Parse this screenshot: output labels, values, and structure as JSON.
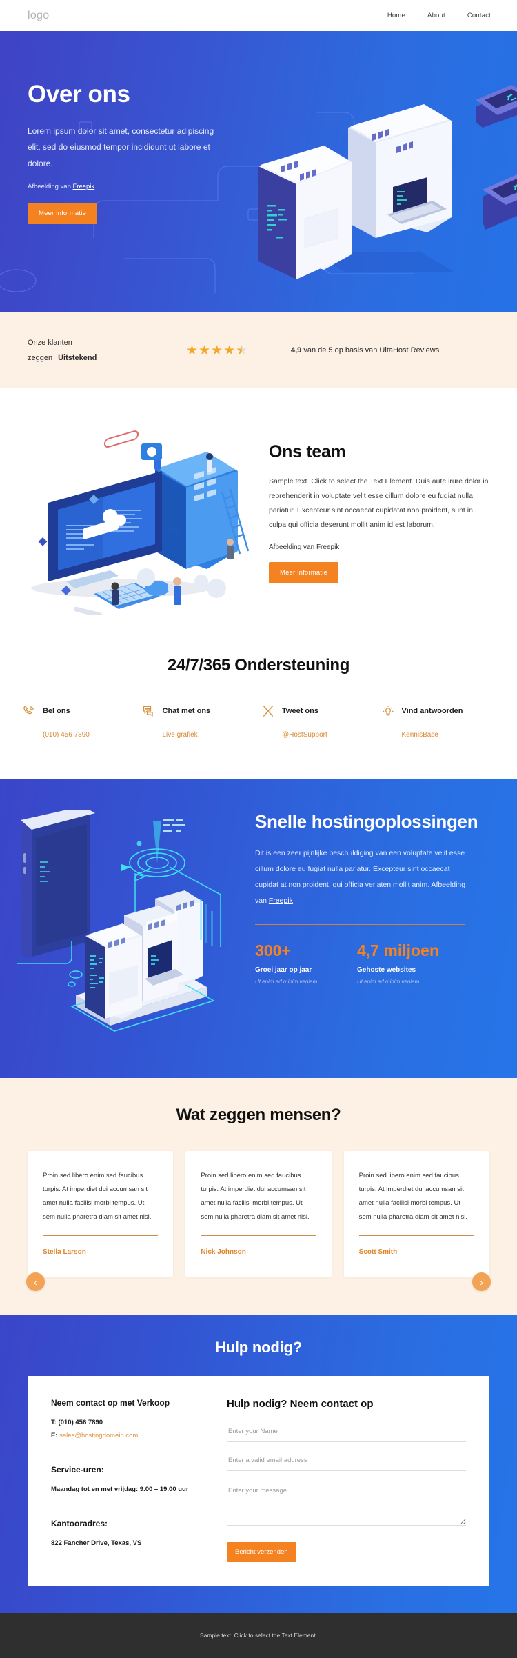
{
  "nav": {
    "logo": "logo",
    "links": [
      {
        "label": "Home"
      },
      {
        "label": "About"
      },
      {
        "label": "Contact"
      }
    ]
  },
  "hero": {
    "title": "Over ons",
    "body": "Lorem ipsum dolor sit amet, consectetur adipiscing elit, sed do eiusmod tempor incididunt ut labore et dolore.",
    "credit_prefix": "Afbeelding van ",
    "credit_link": "Freepik",
    "cta": "Meer informatie",
    "bg_from": "#3f43c4",
    "bg_to": "#2472e6"
  },
  "reviews": {
    "line1": "Onze klanten",
    "line2": "zeggen",
    "rating_word": "Uitstekend",
    "stars": 4.5,
    "score": "4,9",
    "score_text": " van de 5 op basis van UltaHost Reviews",
    "bg": "#fdf0e4",
    "star_color": "#f5a623"
  },
  "team": {
    "title": "Ons team",
    "body": "Sample text. Click to select the Text Element. Duis aute irure dolor in reprehenderit in voluptate velit esse cillum dolore eu fugiat nulla pariatur. Excepteur sint occaecat cupidatat non proident, sunt in culpa qui officia deserunt mollit anim id est laborum.",
    "credit_prefix": "Afbeelding van ",
    "credit_link": "Freepik",
    "cta": "Meer informatie"
  },
  "support": {
    "title": "24/7/365 Ondersteuning",
    "items": [
      {
        "icon": "phone-icon",
        "title": "Bel ons",
        "link": "(010) 456 7890"
      },
      {
        "icon": "chat-icon",
        "title": "Chat met ons",
        "link": "Live grafiek"
      },
      {
        "icon": "x-twitter-icon",
        "title": "Tweet ons",
        "link": "@HostSupport"
      },
      {
        "icon": "lightbulb-icon",
        "title": "Vind antwoorden",
        "link": "KennisBase"
      }
    ]
  },
  "hosting": {
    "title": "Snelle hostingoplossingen",
    "body": "Dit is een zeer pijnlijke beschuldiging van een voluptate velit esse cillum dolore eu fugiat nulla pariatur. Excepteur sint occaecat cupidat at non proident, qui officia verlaten mollit anim. ",
    "credit_prefix": "Afbeelding van ",
    "credit_link": "Freepik",
    "stats": [
      {
        "number": "300+",
        "label": "Groei jaar op jaar",
        "sub": "Ut enim ad minim veniam"
      },
      {
        "number": "4,7 miljoen",
        "label": "Gehoste websites",
        "sub": "Ut enim ad minim veniam"
      }
    ],
    "accent": "#f58220"
  },
  "testimonials": {
    "title": "Wat zeggen mensen?",
    "prev_icon": "chevron-left-icon",
    "next_icon": "chevron-right-icon",
    "cards": [
      {
        "quote": "Proin sed libero enim sed faucibus turpis. At imperdiet dui accumsan sit amet nulla facilisi morbi tempus. Ut sem nulla pharetra diam sit amet nisl.",
        "name": "Stella Larson"
      },
      {
        "quote": "Proin sed libero enim sed faucibus turpis. At imperdiet dui accumsan sit amet nulla facilisi morbi tempus. Ut sem nulla pharetra diam sit amet nisl.",
        "name": "Nick Johnson"
      },
      {
        "quote": "Proin sed libero enim sed faucibus turpis. At imperdiet dui accumsan sit amet nulla facilisi morbi tempus. Ut sem nulla pharetra diam sit amet nisl.",
        "name": "Scott Smith"
      }
    ]
  },
  "contact": {
    "title": "Hulp nodig?",
    "left": {
      "heading": "Neem contact op met Verkoop",
      "phone_label": "T:",
      "phone": " (010) 456 7890",
      "email_label": "E:",
      "email": "sales@hostingdomein.com",
      "hours_heading": "Service-uren:",
      "hours": "Maandag tot en met vrijdag: 9.00 – 19.00 uur",
      "address_heading": "Kantooradres:",
      "address": "822 Fancher Drive, Texas, VS"
    },
    "form": {
      "heading": "Hulp nodig? Neem contact op",
      "name_placeholder": "Enter your Name",
      "email_placeholder": "Enter a valid email address",
      "message_placeholder": "Enter your message",
      "submit": "Bericht verzenden"
    }
  },
  "footer": {
    "text": "Sample text. Click to select the Text Element.",
    "bg": "#2f2f2f"
  }
}
